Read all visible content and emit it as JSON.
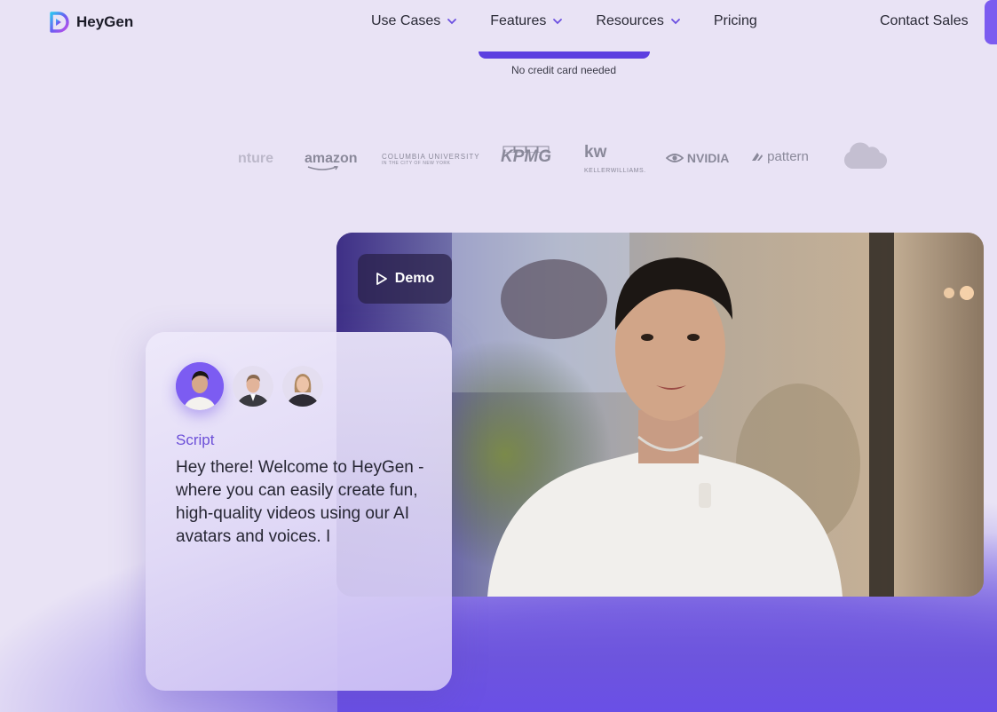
{
  "brand": {
    "name": "HeyGen",
    "accent": "#7b5cf0"
  },
  "nav": {
    "items": [
      {
        "label": "Use Cases",
        "has_dropdown": true
      },
      {
        "label": "Features",
        "has_dropdown": true
      },
      {
        "label": "Resources",
        "has_dropdown": true
      },
      {
        "label": "Pricing",
        "has_dropdown": false
      }
    ],
    "contact": "Contact Sales"
  },
  "hero": {
    "note": "No credit card needed"
  },
  "logos": {
    "accenture": "nture",
    "amazon": "amazon",
    "columbia_line1": "COLUMBIA UNIVERSITY",
    "columbia_line2": "IN THE CITY OF NEW YORK",
    "kpmg": "KPMG",
    "kw_main": "kw",
    "kw_sub": "KELLERWILLIAMS.",
    "nvidia": "NVIDIA",
    "pattern": "pattern"
  },
  "video": {
    "demo_label": "Demo"
  },
  "script_card": {
    "label": "Script",
    "text": "Hey there! Welcome to HeyGen - where you can easily create fun, high-quality videos using our AI avatars and voices. I"
  }
}
